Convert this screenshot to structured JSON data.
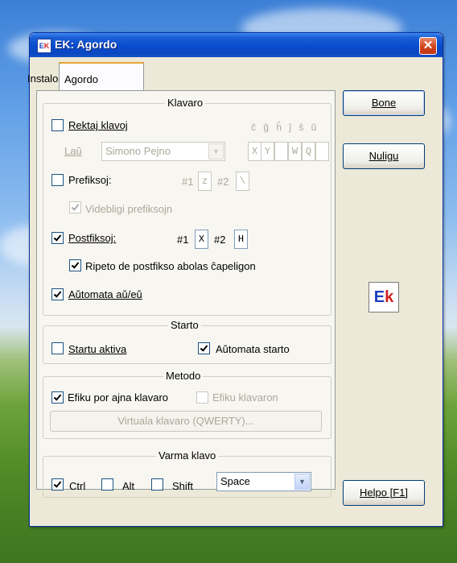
{
  "window": {
    "title": "EK: Agordo",
    "close_glyph": "✕"
  },
  "tabs": [
    {
      "label": "Instalo",
      "active": false
    },
    {
      "label": "Agordo",
      "active": true
    }
  ],
  "klavaro": {
    "title": "Klavaro",
    "rektaj": {
      "label": "Rektaj klavoj",
      "checked": false
    },
    "letters_header": "ĉ ĝ ĥ ĵ ŝ ŭ",
    "lau_label": "Laŭ",
    "layout_select": "Simono Pejno",
    "letter_keys": [
      "X",
      "Y",
      "",
      "W",
      "Q",
      ""
    ],
    "prefiksoj": {
      "label": "Prefiksoj:",
      "checked": false,
      "n1_label": "#1",
      "n1_value": "z",
      "n2_label": "#2",
      "n2_value": "\\"
    },
    "videbligi": {
      "label": "Videbligi prefiksojn",
      "checked": true
    },
    "postfiksoj": {
      "label": "Postfiksoj:",
      "checked": true,
      "n1_label": "#1",
      "n1_value": "X",
      "n2_label": "#2",
      "n2_value": "H"
    },
    "ripeto": {
      "label": "Ripeto de postfikso abolas ĉapeligon",
      "checked": true
    },
    "automata_au": {
      "label": "Aŭtomata aŭ/eŭ",
      "checked": true
    }
  },
  "starto": {
    "title": "Starto",
    "startu_aktiva": {
      "label": "Startu aktiva",
      "checked": false
    },
    "automata_starto": {
      "label": "Aŭtomata starto",
      "checked": true
    }
  },
  "metodo": {
    "title": "Metodo",
    "efiku_por_ajna": {
      "label": "Efiku por ajna klavaro",
      "checked": true
    },
    "efiku_klavaron": {
      "label": "Efiku klavaron",
      "checked": false
    },
    "virtuala_button": "Virtuala klavaro (QWERTY)..."
  },
  "varma_klavo": {
    "title": "Varma klavo",
    "ctrl": {
      "label": "Ctrl",
      "checked": true
    },
    "alt": {
      "label": "Alt",
      "checked": false
    },
    "shift": {
      "label": "Shift",
      "checked": false
    },
    "key_select": "Space"
  },
  "buttons": {
    "bone": "Bone",
    "nuligu": "Nuligu",
    "helpo": "Helpo [F1]"
  },
  "logo": {
    "e": "E",
    "k": "k"
  },
  "tb_icon": {
    "e": "E",
    "k": "K"
  }
}
